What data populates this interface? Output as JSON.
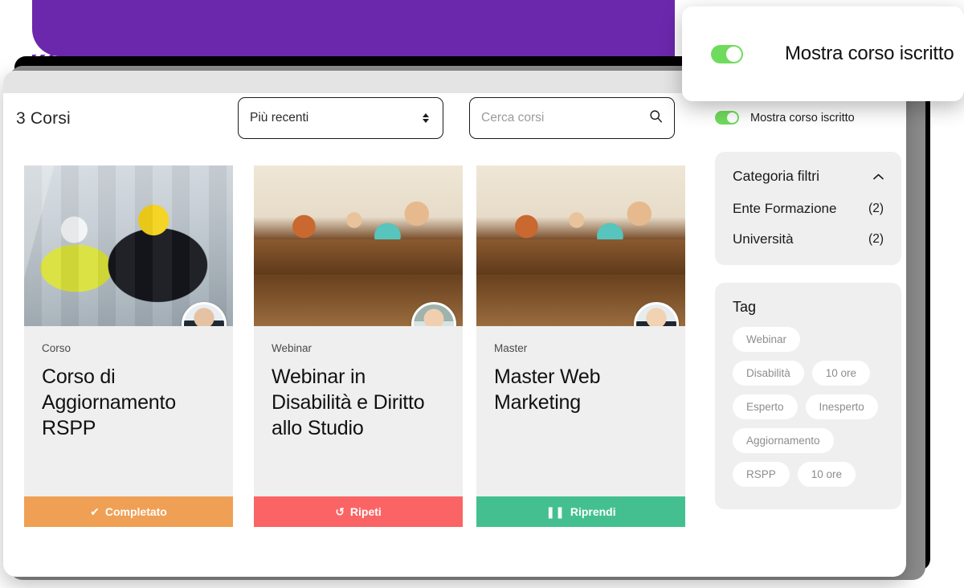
{
  "header": {
    "count_label": "3 Corsi",
    "sort_select": {
      "value": "Più recenti",
      "icon": "select-arrows-icon"
    },
    "search": {
      "value": "",
      "placeholder": "Cerca corsi",
      "icon": "search-icon"
    }
  },
  "cards": [
    {
      "kicker": "Corso",
      "title": "Corso di Aggiornamento RSPP",
      "cta_label": "Completato",
      "cta_icon": "✔",
      "cta_icon_name": "check-icon",
      "cta_color": "#EFA054",
      "image_name": "industrial-worker-photo",
      "avatar_name": "instructor-avatar"
    },
    {
      "kicker": "Webinar",
      "title": "Webinar in Disabilità e Diritto allo Studio",
      "cta_label": "Ripeti",
      "cta_icon": "↺",
      "cta_icon_name": "repeat-icon",
      "cta_color": "#FB6464",
      "image_name": "classroom-photo",
      "avatar_name": "instructor-avatar"
    },
    {
      "kicker": "Master",
      "title": "Master Web Marketing",
      "cta_label": "Riprendi",
      "cta_icon": "❚❚",
      "cta_icon_name": "pause-icon",
      "cta_color": "#44C090",
      "image_name": "classroom-photo",
      "avatar_name": "instructor-avatar"
    }
  ],
  "rail": {
    "toggle_label": "Mostra corso iscritto",
    "toggle_on": true,
    "filters_panel": {
      "title": "Categoria filtri",
      "collapse_icon": "chevron-up-icon",
      "items": [
        {
          "label": "Ente Formazione",
          "count": "(2)"
        },
        {
          "label": "Università",
          "count": "(2)"
        }
      ]
    },
    "tags_panel": {
      "title": "Tag",
      "rows": [
        [
          "Webinar"
        ],
        [
          "Disabilità",
          "10 ore"
        ],
        [
          "Esperto",
          "Inesperto"
        ],
        [
          "Aggiornamento"
        ],
        [
          "RSPP",
          "10 ore"
        ]
      ]
    }
  },
  "popup": {
    "label": "Mostra corso iscritto",
    "toggle_on": true
  },
  "theme": {
    "purple": "#6B28AC",
    "toggle_green": "#6FDB5C",
    "card_bg": "#EFEFEF",
    "chip_bg": "#FFFFFF"
  }
}
